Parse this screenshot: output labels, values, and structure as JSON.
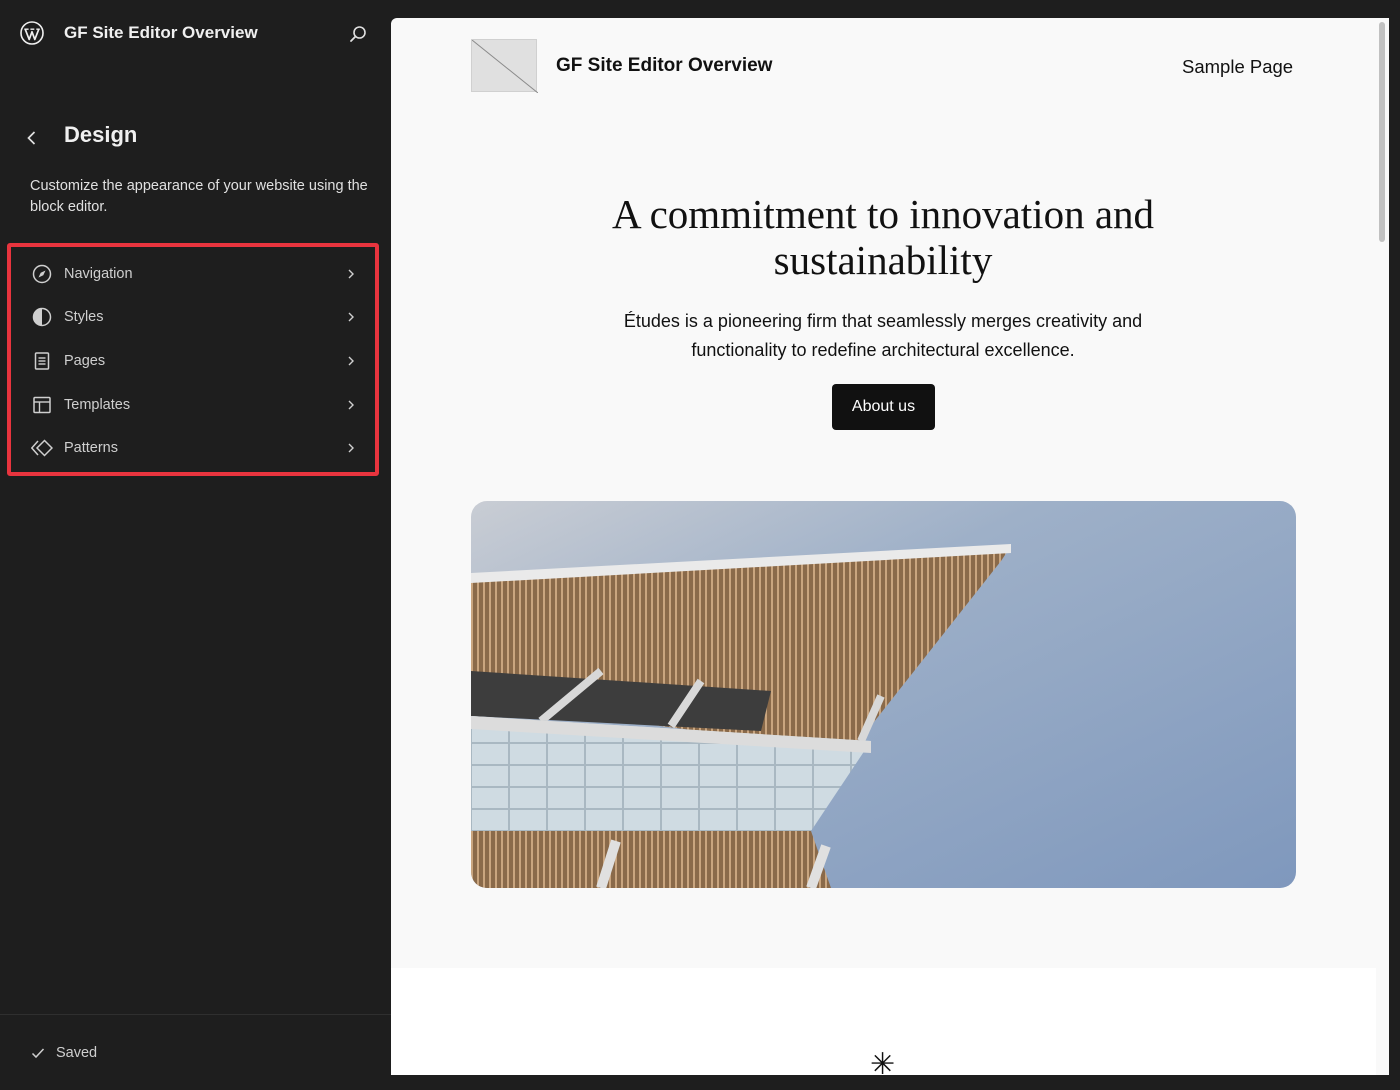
{
  "sidebar": {
    "site_title": "GF Site Editor Overview",
    "section_title": "Design",
    "description": "Customize the appearance of your website using the block editor.",
    "items": [
      {
        "label": "Navigation",
        "icon": "navigation-icon"
      },
      {
        "label": "Styles",
        "icon": "styles-icon"
      },
      {
        "label": "Pages",
        "icon": "pages-icon"
      },
      {
        "label": "Templates",
        "icon": "templates-icon"
      },
      {
        "label": "Patterns",
        "icon": "patterns-icon"
      }
    ],
    "status": "Saved",
    "highlight_color": "#e8343e"
  },
  "preview": {
    "site_title": "GF Site Editor Overview",
    "nav_link": "Sample Page",
    "hero_heading": "A commitment to innovation and sustainability",
    "hero_text": "Études is a pioneering firm that seamlessly merges creativity and functionality to redefine architectural excellence.",
    "cta_label": "About us",
    "separator": "✳"
  }
}
